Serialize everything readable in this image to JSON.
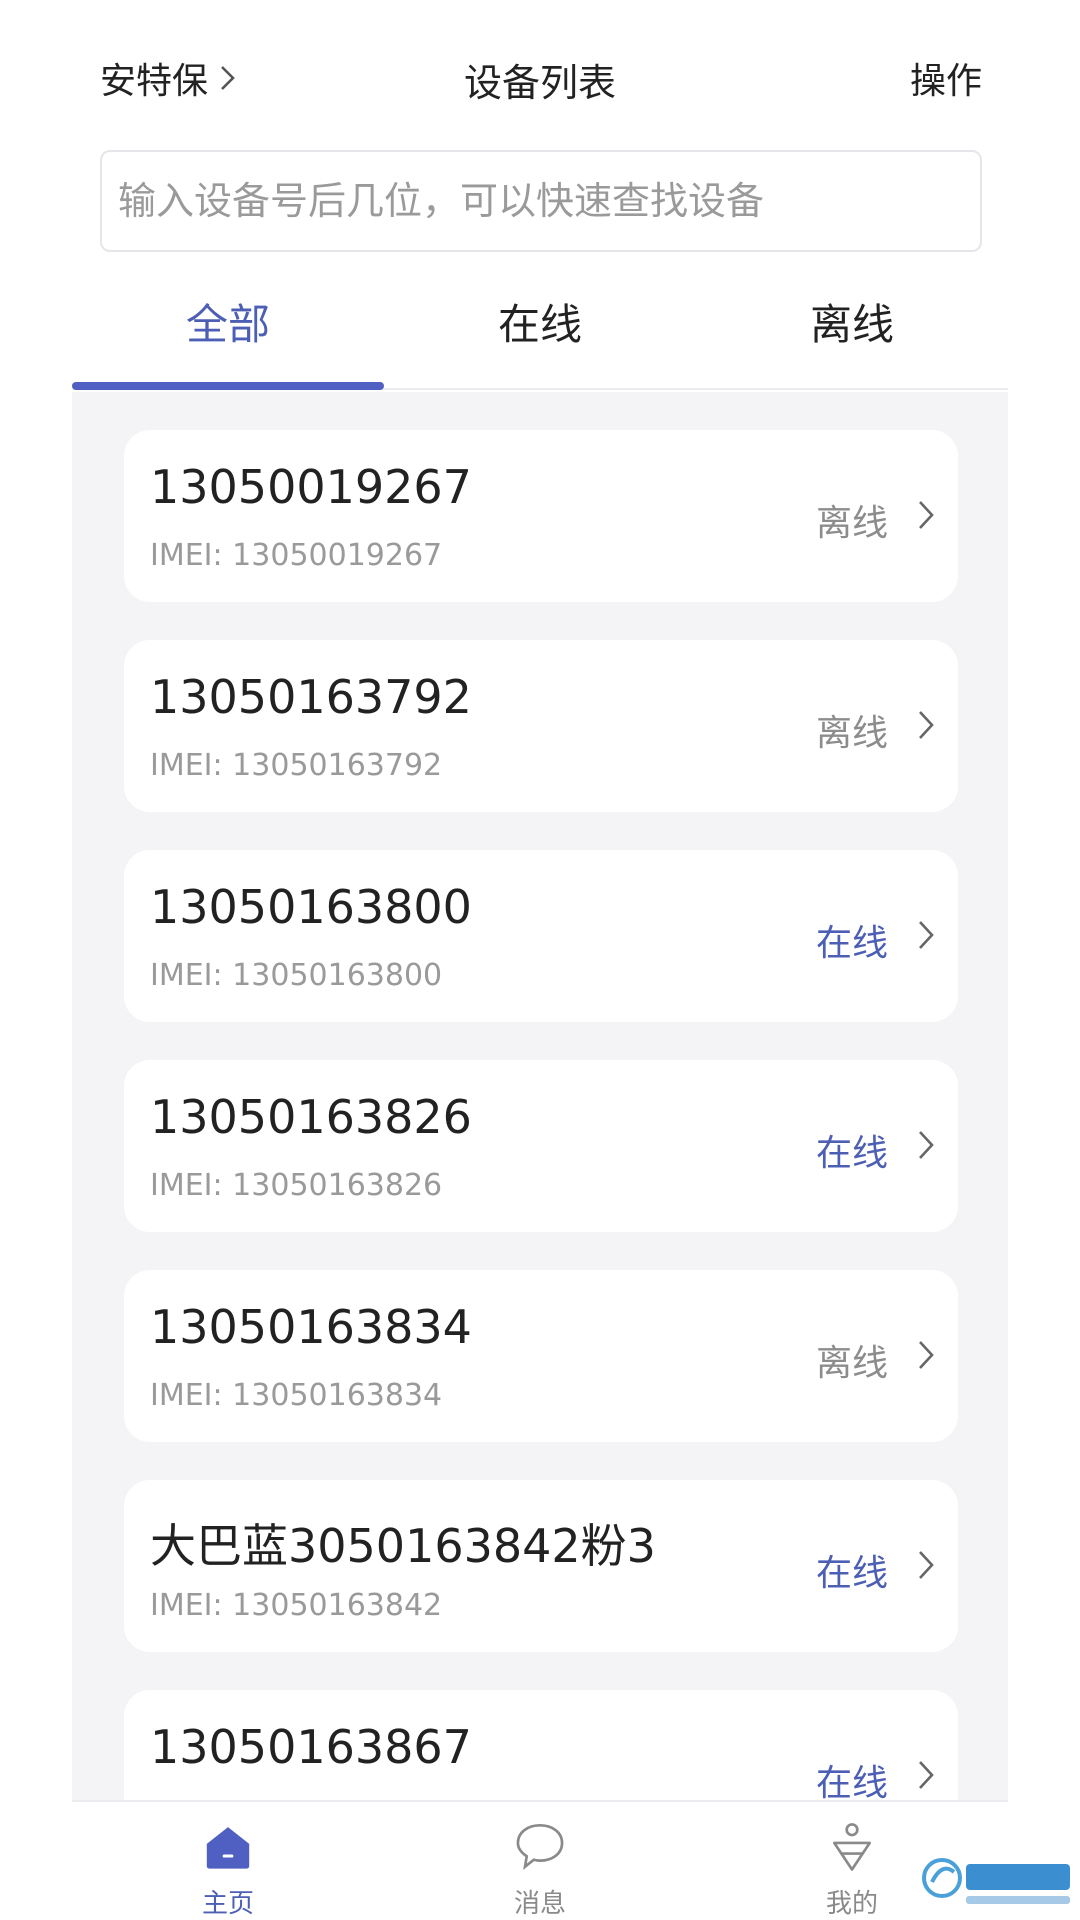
{
  "header": {
    "brand": "安特保",
    "title": "设备列表",
    "ops_label": "操作"
  },
  "search": {
    "placeholder": "输入设备号后几位，可以快速查找设备"
  },
  "tabs": [
    {
      "label": "全部",
      "active": true
    },
    {
      "label": "在线",
      "active": false
    },
    {
      "label": "离线",
      "active": false
    }
  ],
  "devices": [
    {
      "name": "13050019267",
      "imei": "IMEI: 13050019267",
      "status": "离线"
    },
    {
      "name": "13050163792",
      "imei": "IMEI: 13050163792",
      "status": "离线"
    },
    {
      "name": "13050163800",
      "imei": "IMEI: 13050163800",
      "status": "在线"
    },
    {
      "name": "13050163826",
      "imei": "IMEI: 13050163826",
      "status": "在线"
    },
    {
      "name": "13050163834",
      "imei": "IMEI: 13050163834",
      "status": "离线"
    },
    {
      "name": "大巴蓝3050163842粉3",
      "imei": "IMEI: 13050163842",
      "status": "在线"
    },
    {
      "name": "13050163867",
      "imei": "",
      "status": "在线"
    }
  ],
  "bottom_nav": [
    {
      "label": "主页",
      "icon": "home-icon",
      "active": true
    },
    {
      "label": "消息",
      "icon": "message-icon",
      "active": false
    },
    {
      "label": "我的",
      "icon": "profile-icon",
      "active": false
    }
  ],
  "colors": {
    "accent": "#4c5fb4",
    "online": "#4c5fb4",
    "offline": "#8c8c8c",
    "list_bg": "#f4f4f7"
  }
}
